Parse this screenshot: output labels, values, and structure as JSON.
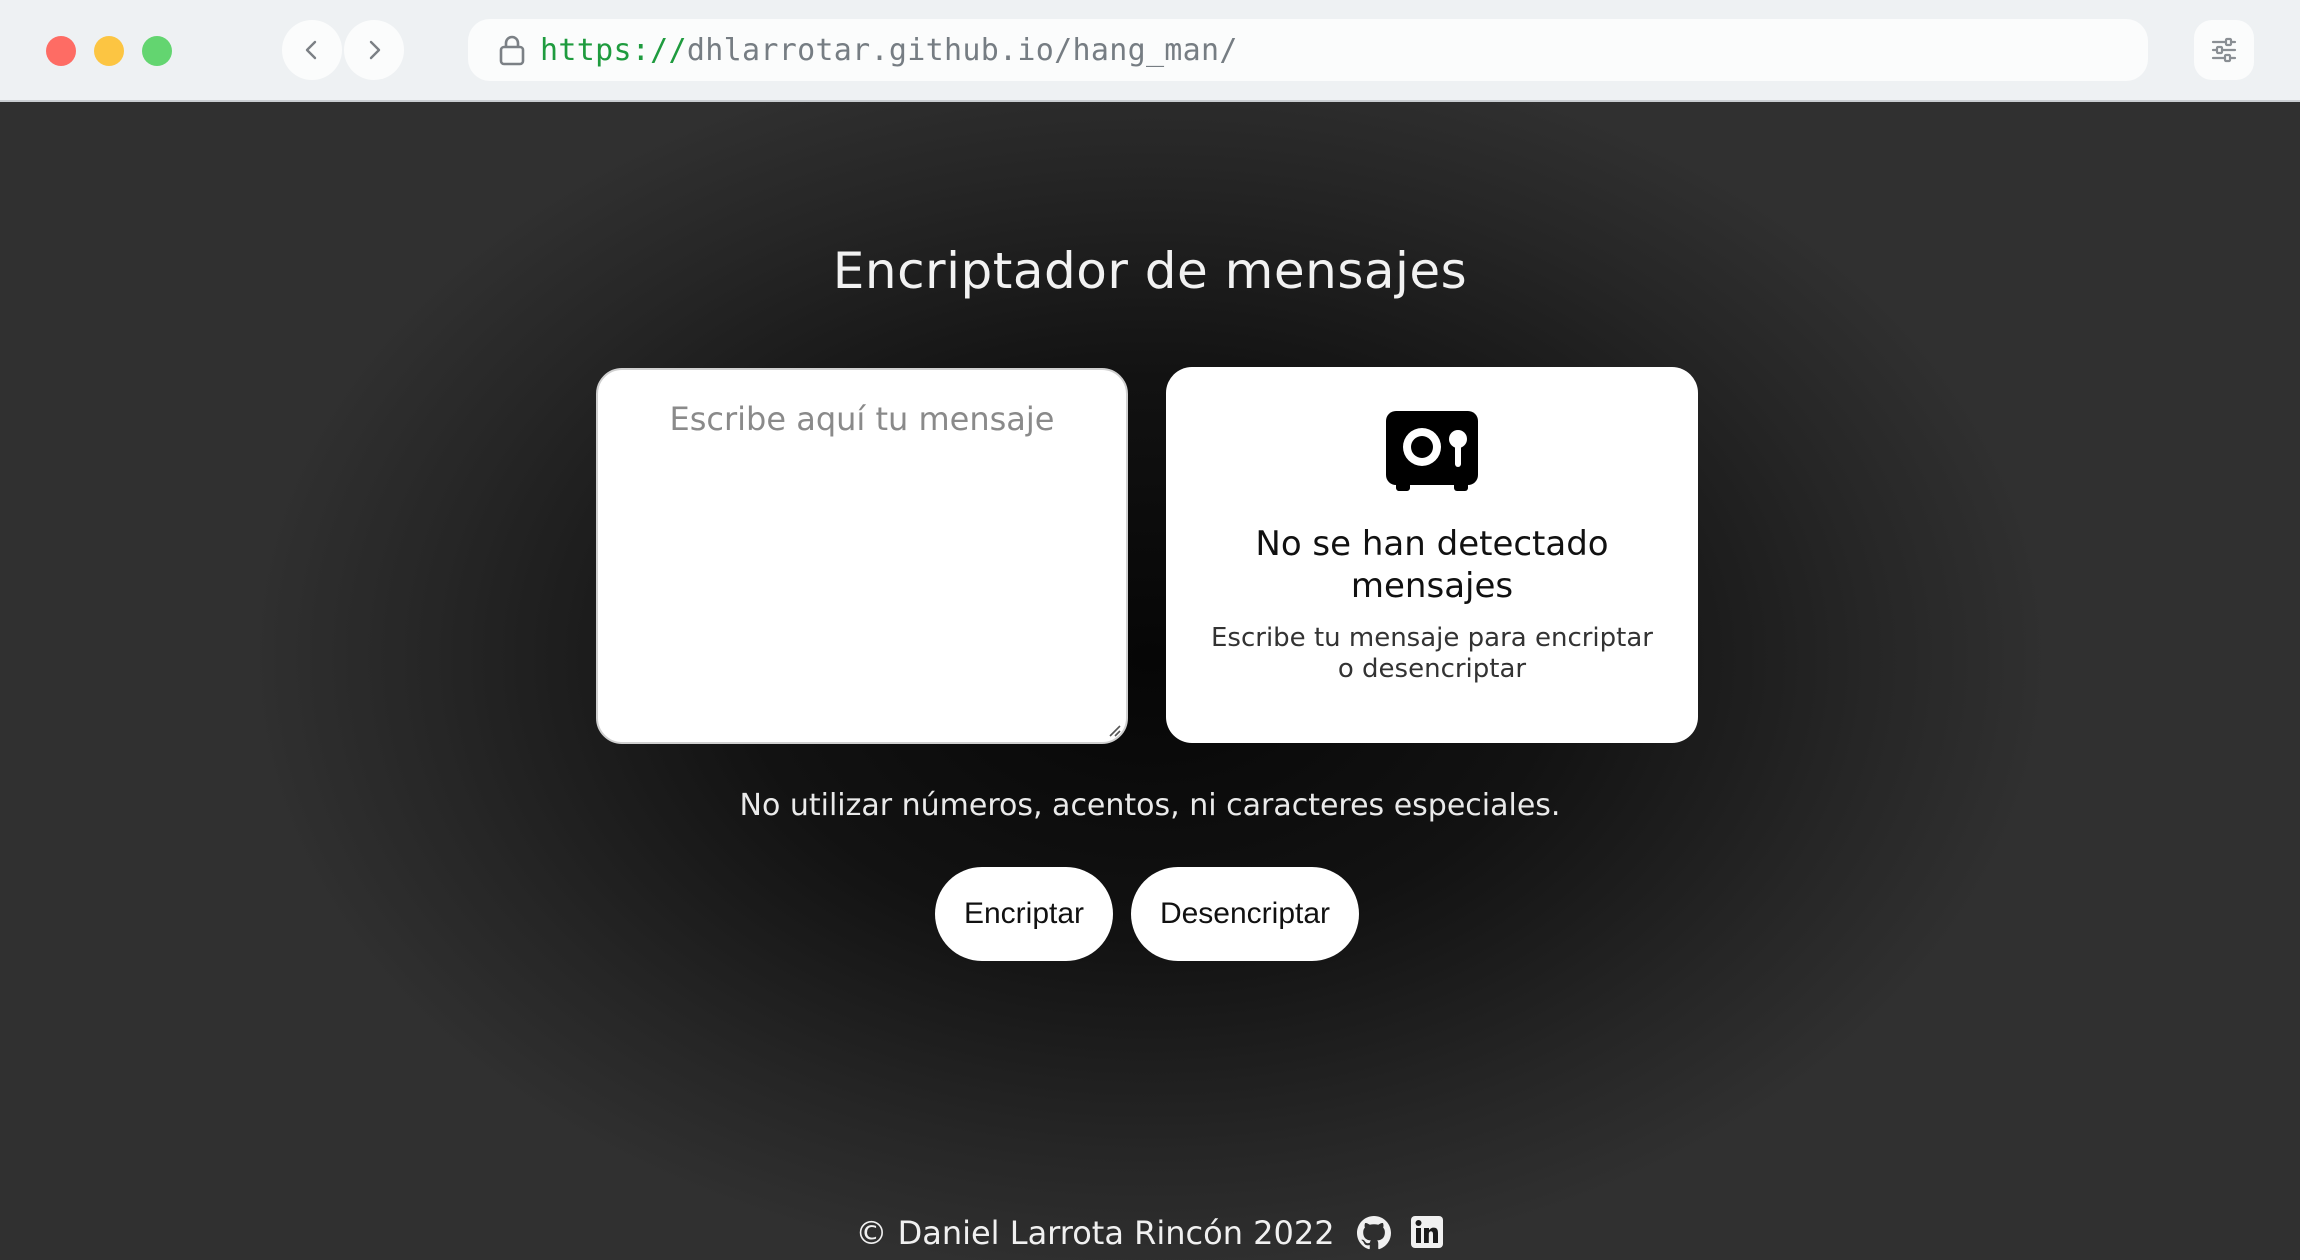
{
  "browser": {
    "url_scheme": "https://",
    "url_rest": "dhlarrotar.github.io/hang_man/",
    "traffic_light_colors": {
      "close": "#fe5f57",
      "minimize": "#febc2e",
      "maximize": "#28c840"
    },
    "icons": [
      "back-icon",
      "forward-icon",
      "lock-icon",
      "settings-sliders-icon"
    ]
  },
  "page": {
    "title": "Encriptador de mensajes",
    "input": {
      "placeholder": "Escribe aquí tu mensaje",
      "value": ""
    },
    "output": {
      "icon": "safe-icon",
      "empty_title": "No se han detectado mensajes",
      "empty_description": "Escribe tu mensaje para encriptar o desencriptar"
    },
    "hint": "No utilizar números, acentos, ni caracteres especiales.",
    "buttons": {
      "encrypt_label": "Encriptar",
      "decrypt_label": "Desencriptar"
    },
    "footer": {
      "copyright": "© Daniel Larrota Rincón 2022",
      "icons": [
        "github-icon",
        "linkedin-icon"
      ]
    }
  }
}
